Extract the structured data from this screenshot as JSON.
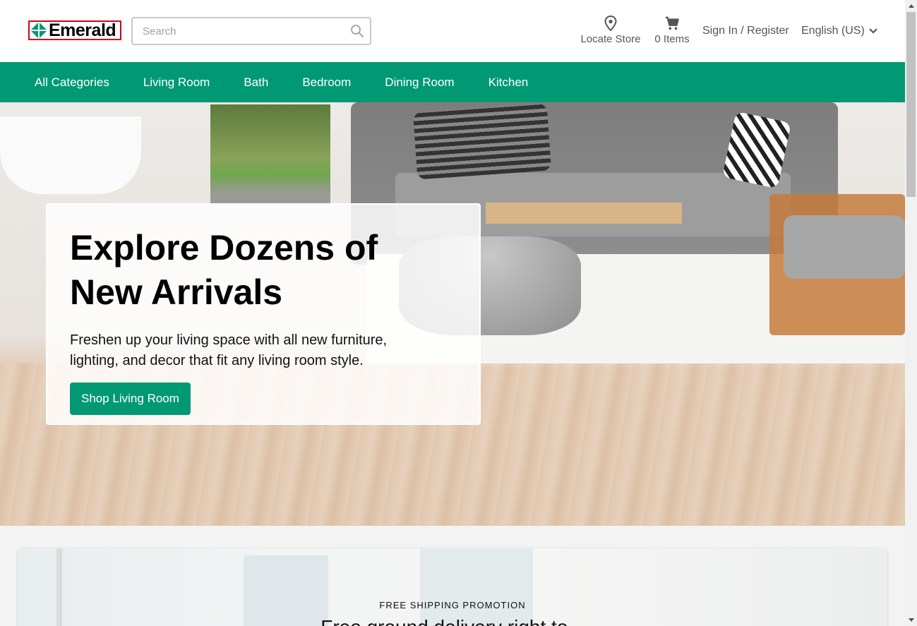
{
  "brand": {
    "name": "Emerald",
    "accent": "#009974"
  },
  "search": {
    "placeholder": "Search",
    "value": ""
  },
  "header_tools": {
    "locate_label": "Locate Store",
    "cart_label": "0 Items",
    "signin_label": "Sign In / Register",
    "language_label": "English (US)"
  },
  "nav": {
    "items": [
      "All Categories",
      "Living Room",
      "Bath",
      "Bedroom",
      "Dining Room",
      "Kitchen"
    ]
  },
  "hero": {
    "title_line1": "Explore Dozens of",
    "title_line2": "New Arrivals",
    "subtitle_line1": "Freshen up your living space with all new furniture,",
    "subtitle_line2": "lighting, and decor that fit any living room style.",
    "cta_label": "Shop Living Room"
  },
  "promo": {
    "eyebrow": "FREE SHIPPING PROMOTION",
    "title_partial": "Free ground delivery right to..."
  },
  "icons": {
    "search": "search-icon",
    "locate": "map-pin-icon",
    "cart": "cart-icon",
    "language": "chevron-down-icon"
  }
}
